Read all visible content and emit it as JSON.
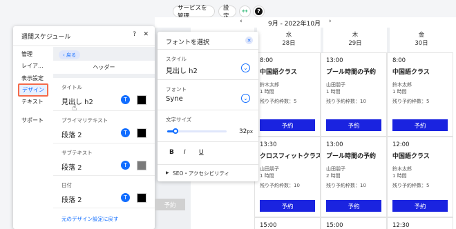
{
  "top": {
    "manage_services": "サービスを管理",
    "settings": "設定"
  },
  "calendar": {
    "month_label": "9月 - 2022年10月",
    "days": [
      {
        "dow": "水",
        "date": "28日"
      },
      {
        "dow": "木",
        "date": "29日"
      },
      {
        "dow": "金",
        "date": "30日"
      }
    ],
    "events": [
      {
        "time": "8:00",
        "name": "中国語クラス",
        "staff": "鈴木太郎",
        "duration": "1 時間",
        "remaining": "残り予約枠数：5",
        "book": "予約"
      },
      {
        "time": "13:00",
        "name": "プール時間の予約",
        "staff": "山田朋子",
        "duration": "1 時間",
        "remaining": "残り予約枠数：10",
        "book": "予約"
      },
      {
        "time": "8:00",
        "name": "中国語クラス",
        "staff": "鈴木太郎",
        "duration": "1 時間",
        "remaining": "残り予約枠数：5",
        "book": "予約"
      },
      {
        "time": "13:30",
        "name": "クロスフィットクラス",
        "staff": "山田朋子",
        "duration": "1 時間",
        "remaining": "残り予約枠数：10",
        "book": "予約"
      },
      {
        "time": "13:00",
        "name": "プール時間の予約",
        "staff": "山田朋子",
        "duration": "2 時間",
        "remaining": "残り予約枠数：10",
        "book": "予約"
      },
      {
        "time": "12:00",
        "name": "中国語クラス",
        "staff": "鈴木太郎",
        "duration": "1 時間",
        "remaining": "残り予約枠数：5",
        "book": "予約"
      },
      {
        "time": "15:00"
      },
      {
        "time": "15:00"
      },
      {
        "time": "12:30"
      }
    ]
  },
  "panel": {
    "title": "週間スケジュール",
    "help": "?",
    "close": "✕",
    "nav": [
      "管理",
      "レイア...",
      "表示設定",
      "デザイン",
      "テキスト",
      "サポート"
    ],
    "back": "‹ 戻る",
    "section_header": "ヘッダー",
    "rows": [
      {
        "label": "タイトル",
        "value": "見出し h2",
        "color": "#000000"
      },
      {
        "label": "プライマリテキスト",
        "value": "段落 2",
        "color": "#000000"
      },
      {
        "label": "サブテキスト",
        "value": "段落 2",
        "color": "#7a7a7a"
      },
      {
        "label": "日付",
        "value": "段落 2",
        "color": "#000000"
      }
    ],
    "restore": "元のデザイン設定に戻す",
    "ghost_button": "予約"
  },
  "font_panel": {
    "title": "フォントを選択",
    "style_label": "スタイル",
    "style_value": "見出し h2",
    "font_label": "フォント",
    "font_value": "Syne",
    "size_label": "文字サイズ",
    "size_value": "32",
    "size_unit": "px",
    "size_fraction": 0.14,
    "bold": "B",
    "italic": "I",
    "underline": "U",
    "seo": "SEO・アクセシビリティ"
  },
  "colors": {
    "accent": "#116dff",
    "book": "#1a23e0"
  }
}
